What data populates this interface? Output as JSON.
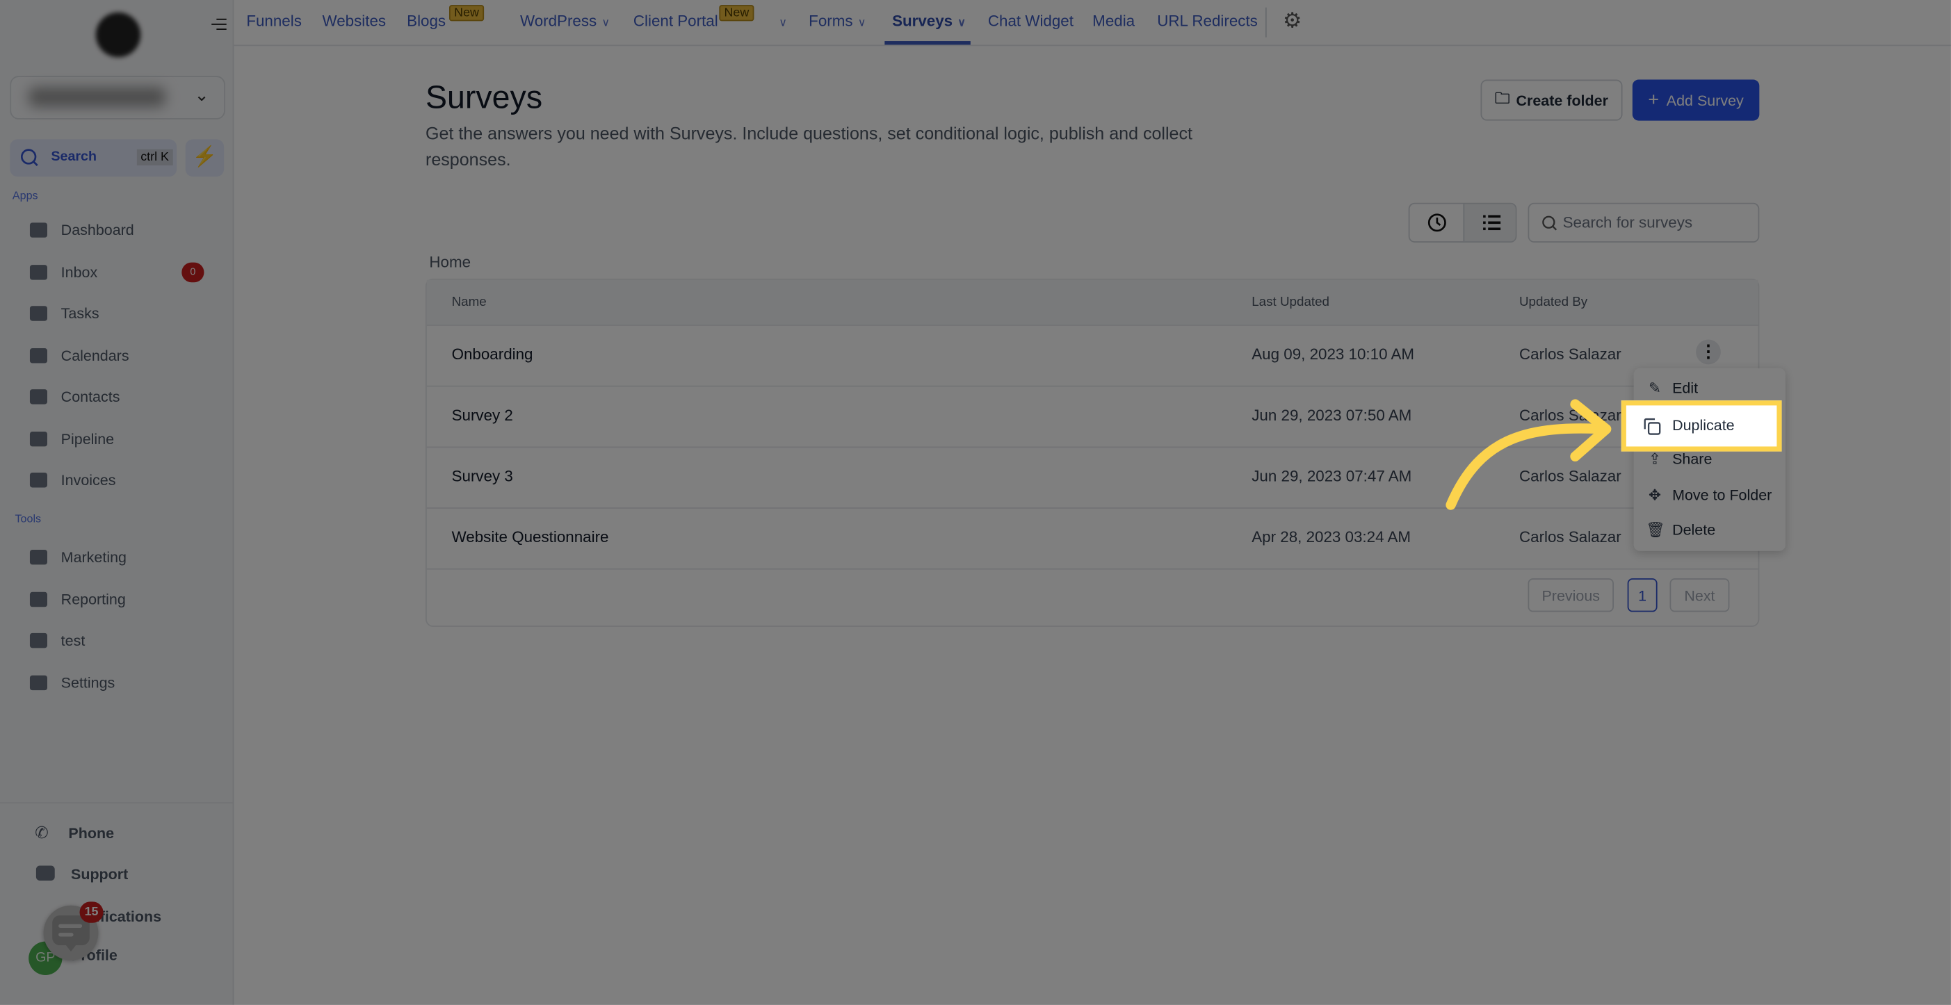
{
  "sidebar": {
    "search_label": "Search",
    "search_shortcut": "ctrl K",
    "apps_label": "Apps",
    "tools_label": "Tools",
    "apps": [
      {
        "label": "Dashboard",
        "icon": "dashboard-icon"
      },
      {
        "label": "Inbox",
        "icon": "inbox-icon",
        "badge": "0"
      },
      {
        "label": "Tasks",
        "icon": "tasks-icon"
      },
      {
        "label": "Calendars",
        "icon": "calendar-icon"
      },
      {
        "label": "Contacts",
        "icon": "contacts-icon"
      },
      {
        "label": "Pipeline",
        "icon": "funnel-icon"
      },
      {
        "label": "Invoices",
        "icon": "invoice-icon"
      }
    ],
    "tools": [
      {
        "label": "Marketing",
        "icon": "megaphone-icon"
      },
      {
        "label": "Reporting",
        "icon": "pie-chart-icon"
      },
      {
        "label": "test",
        "icon": "accessibility-icon"
      },
      {
        "label": "Settings",
        "icon": "gear-icon"
      }
    ],
    "bottom": {
      "phone": "Phone",
      "support": "Support",
      "notifications": "Notifications",
      "profile": "Profile",
      "avatar_initials": "GP",
      "chat_badge": "15"
    }
  },
  "topnav": {
    "items": [
      "Funnels",
      "Websites",
      "Blogs",
      "WordPress",
      "Client Portal",
      "Forms",
      "Surveys",
      "Chat Widget",
      "Media",
      "URL Redirects"
    ],
    "new_badge": "New",
    "active": "Surveys"
  },
  "main": {
    "title": "Surveys",
    "subtitle": "Get the answers you need with Surveys. Include questions, set conditional logic, publish and collect responses.",
    "create_folder": "Create folder",
    "add_survey": "Add Survey",
    "search_placeholder": "Search for surveys",
    "breadcrumb": "Home",
    "columns": [
      "Name",
      "Last Updated",
      "Updated By"
    ],
    "rows": [
      {
        "name": "Onboarding",
        "updated": "Aug 09, 2023 10:10 AM",
        "by": "Carlos Salazar"
      },
      {
        "name": "Survey 2",
        "updated": "Jun 29, 2023 07:50 AM",
        "by": "Carlos Salazar"
      },
      {
        "name": "Survey 3",
        "updated": "Jun 29, 2023 07:47 AM",
        "by": "Carlos Salazar"
      },
      {
        "name": "Website Questionnaire",
        "updated": "Apr 28, 2023 03:24 AM",
        "by": "Carlos Salazar"
      }
    ],
    "pagination": {
      "previous": "Previous",
      "page": "1",
      "next": "Next"
    }
  },
  "context_menu": {
    "items": [
      "Edit",
      "Duplicate",
      "Share",
      "Move to Folder",
      "Delete"
    ],
    "highlighted": "Duplicate"
  },
  "colors": {
    "accent": "#2952e8",
    "highlight": "#fcd34d",
    "badge": "#c81e1e"
  }
}
